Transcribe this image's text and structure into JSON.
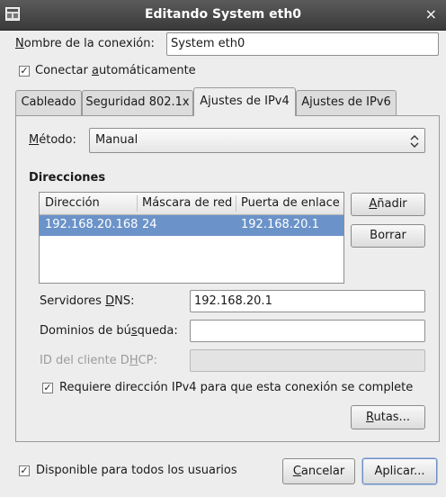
{
  "window": {
    "title": "Editando System eth0",
    "close_glyph": "×",
    "icon": "window-menu-icon"
  },
  "connection_name": {
    "label_u": "N",
    "label_rest": "ombre de la conexión:",
    "value": "System eth0"
  },
  "auto_connect": {
    "checked": true,
    "label_pre": "Conectar ",
    "label_u": "a",
    "label_post": "utomáticamente"
  },
  "tabs": [
    {
      "label": "Cableado",
      "active": false
    },
    {
      "label": "Seguridad 802.1x",
      "active": false
    },
    {
      "label": "Ajustes de IPv4",
      "active": true
    },
    {
      "label": "Ajustes de IPv6",
      "active": false
    }
  ],
  "method": {
    "label_u": "M",
    "label_rest": "étodo:",
    "value": "Manual"
  },
  "addresses": {
    "heading": "Direcciones",
    "columns": [
      "Dirección",
      "Máscara de red",
      "Puerta de enlace"
    ],
    "rows": [
      {
        "address": "192.168.20.168",
        "netmask": "24",
        "gateway": "192.168.20.1",
        "selected": true
      }
    ],
    "add_pre": "",
    "add_u": "A",
    "add_post": "ñadir",
    "delete_label": "Borrar"
  },
  "dns": {
    "label_pre": "Servidores ",
    "label_u": "D",
    "label_post": "NS:",
    "value": "192.168.20.1"
  },
  "search_domains": {
    "label_pre": "Dominios de bú",
    "label_u": "s",
    "label_post": "queda:",
    "value": ""
  },
  "dhcp_client_id": {
    "label_pre": "ID del cliente D",
    "label_u": "H",
    "label_post": "CP:",
    "value": ""
  },
  "require_ipv4": {
    "checked": true,
    "label": "Requiere dirección IPv4 para que esta conexión se complete"
  },
  "routes": {
    "label_u": "R",
    "label_rest": "utas..."
  },
  "available_all": {
    "checked": true,
    "label": "Disponible para todos los usuarios"
  },
  "cancel": {
    "label_u": "C",
    "label_rest": "ancelar"
  },
  "apply": {
    "label": "Aplicar..."
  },
  "colors": {
    "titlebar": "#3a3a3a",
    "selection": "#6b93c9",
    "accent": "#86a8d8"
  }
}
